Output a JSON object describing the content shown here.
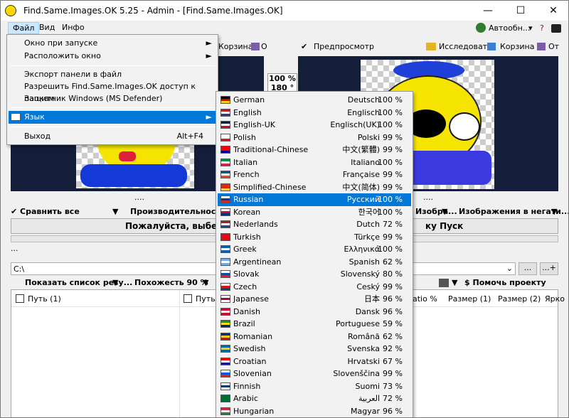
{
  "window": {
    "title": "Find.Same.Images.OK 5.25 - Admin - [Find.Same.Images.OK]",
    "min": "—",
    "max": "☐",
    "close": "✕"
  },
  "menubar": {
    "file": "Файл",
    "view": "Вид",
    "info": "Инфо",
    "autoupdate": "Автообн...",
    "autoupdate_arrow": "▾",
    "extra": "?"
  },
  "toolbar_left": {
    "trash": "Корзина",
    "o": "О"
  },
  "toolbar_right": {
    "preview": "Предпросмотр",
    "explore": "Исследовать",
    "trash": "Корзина",
    "ot": "От"
  },
  "zoom": {
    "percent": "100 %",
    "angle": "180 °"
  },
  "dots_left": "....",
  "dots_right": "....",
  "compare": {
    "label": "Сравнить все",
    "perf": "Производительность/К",
    "images_neg": "Изображения в негати...",
    "izobra": "Изобра..."
  },
  "status": {
    "left": "Пожалуйста, выбери",
    "right": "ку Пуск"
  },
  "dots_mid": "...",
  "path": {
    "value": "C:\\",
    "btn1": "...",
    "btn2": "...+"
  },
  "results": {
    "show": "Показать список резу...",
    "similarity": "Похожесть 90 %",
    "donate": "$ Помочь проекту"
  },
  "columns": {
    "path1": "Путь (1)",
    "path2": "Путь (2",
    "ratio": "atio %",
    "size1": "Размер (1)",
    "size2": "Размер (2)",
    "bright": "Ярко"
  },
  "file_menu": [
    {
      "label": "Окно при запуске",
      "arrow": "►"
    },
    {
      "label": "Расположить окно",
      "arrow": "►"
    },
    {
      "label": "Экспорт панели в файл"
    },
    {
      "label": "Разрешить Find.Same.Images.OK доступ к папкам"
    },
    {
      "label": "Защитник Windows (MS Defender)"
    },
    {
      "label": "Язык",
      "arrow": "►"
    },
    {
      "label": "Выход",
      "shortcut": "Alt+F4"
    }
  ],
  "languages": [
    {
      "name": "German",
      "native": "Deutsch",
      "pct": "100 %",
      "flag": "#000000|#dd0000|#ffce00"
    },
    {
      "name": "English",
      "native": "Englisch",
      "pct": "100 %",
      "flag": "#b22234|#ffffff|#3c3b6e"
    },
    {
      "name": "English-UK",
      "native": "Englisch(UK)",
      "pct": "100 %",
      "flag": "#012169|#ffffff|#c8102e"
    },
    {
      "name": "Polish",
      "native": "Polski",
      "pct": "99 %",
      "flag": "#ffffff|#ffffff|#dc143c"
    },
    {
      "name": "Traditional-Chinese",
      "native": "中文(繁體)",
      "pct": "99 %",
      "flag": "#fe0000|#fe0000|#000095"
    },
    {
      "name": "Italian",
      "native": "Italiano",
      "pct": "100 %",
      "flag": "#009246|#ffffff|#ce2b37"
    },
    {
      "name": "French",
      "native": "Française",
      "pct": "99 %",
      "flag": "#0055a4|#ffffff|#ef4135"
    },
    {
      "name": "Simplified-Chinese",
      "native": "中文(简体)",
      "pct": "99 %",
      "flag": "#de2910|#de2910|#ffde00"
    },
    {
      "name": "Russian",
      "native": "Русский",
      "pct": "100 %",
      "flag": "#ffffff|#0039a6|#d52b1e"
    },
    {
      "name": "Korean",
      "native": "한국어",
      "pct": "100 %",
      "flag": "#ffffff|#c60c30|#003478"
    },
    {
      "name": "Nederlands",
      "native": "Dutch",
      "pct": "72 %",
      "flag": "#ae1c28|#ffffff|#21468b"
    },
    {
      "name": "Turkish",
      "native": "Türkçe",
      "pct": "99 %",
      "flag": "#e30a17|#e30a17|#e30a17"
    },
    {
      "name": "Greek",
      "native": "Ελληνικά",
      "pct": "100 %",
      "flag": "#0d5eaf|#ffffff|#0d5eaf"
    },
    {
      "name": "Argentinean",
      "native": "Spanish",
      "pct": "62 %",
      "flag": "#74acdf|#ffffff|#74acdf"
    },
    {
      "name": "Slovak",
      "native": "Slovenský",
      "pct": "80 %",
      "flag": "#ffffff|#0b4ea2|#ee1c25"
    },
    {
      "name": "Czech",
      "native": "Ceský",
      "pct": "99 %",
      "flag": "#ffffff|#d7141a|#11457e"
    },
    {
      "name": "Japanese",
      "native": "日本",
      "pct": "96 %",
      "flag": "#ffffff|#bc002d|#ffffff"
    },
    {
      "name": "Danish",
      "native": "Dansk",
      "pct": "96 %",
      "flag": "#c8102e|#ffffff|#c8102e"
    },
    {
      "name": "Brazil",
      "native": "Portuguese",
      "pct": "59 %",
      "flag": "#009c3b|#ffdf00|#002776"
    },
    {
      "name": "Romanian",
      "native": "Română",
      "pct": "62 %",
      "flag": "#002b7f|#fcd116|#ce1126"
    },
    {
      "name": "Swedish",
      "native": "Svenska",
      "pct": "92 %",
      "flag": "#006aa7|#fecc00|#006aa7"
    },
    {
      "name": "Croatian",
      "native": "Hrvatski",
      "pct": "67 %",
      "flag": "#ff0000|#ffffff|#171796"
    },
    {
      "name": "Slovenian",
      "native": "Slovenščina",
      "pct": "99 %",
      "flag": "#ffffff|#005ce5|#ed1c24"
    },
    {
      "name": "Finnish",
      "native": "Suomi",
      "pct": "73 %",
      "flag": "#ffffff|#003580|#ffffff"
    },
    {
      "name": "Arabic",
      "native": "العربية",
      "pct": "72 %",
      "flag": "#006c35|#006c35|#006c35"
    },
    {
      "name": "Hungarian",
      "native": "Magyar",
      "pct": "96 %",
      "flag": "#ce2939|#ffffff|#477050"
    }
  ],
  "selected_language": "Russian",
  "colors": {
    "accent": "#0078d7",
    "dark_panel": "#141e3a",
    "menu_hover": "#cce8ff"
  }
}
